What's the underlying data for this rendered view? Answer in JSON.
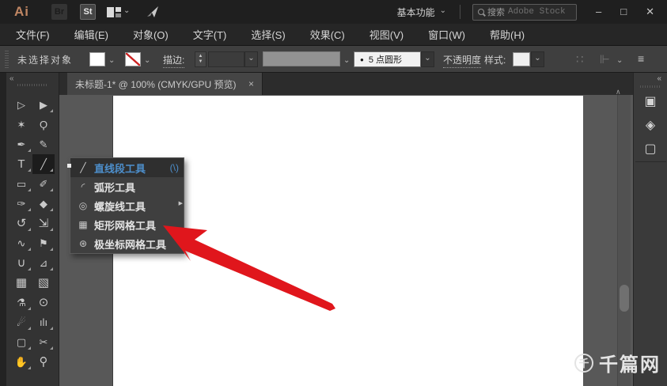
{
  "titlebar": {
    "app_badge": "Ai",
    "bridge_badge": "Br",
    "stock_badge": "St",
    "workspace_label": "基本功能",
    "search_label": "搜索",
    "search_placeholder": "Adobe Stock",
    "minimize": "–",
    "maximize": "□",
    "close": "✕"
  },
  "menubar": {
    "items": [
      {
        "label": "文件(F)"
      },
      {
        "label": "编辑(E)"
      },
      {
        "label": "对象(O)"
      },
      {
        "label": "文字(T)"
      },
      {
        "label": "选择(S)"
      },
      {
        "label": "效果(C)"
      },
      {
        "label": "视图(V)"
      },
      {
        "label": "窗口(W)"
      },
      {
        "label": "帮助(H)"
      }
    ]
  },
  "control_bar": {
    "status": "未选择对象",
    "stroke_label": "描边:",
    "stepper_up": "▲",
    "stepper_down": "▼",
    "brush_bullet": "●",
    "brush_value": "5 点圆形",
    "opacity_label": "不透明度",
    "style_label": "样式:",
    "transform_icon": "∷",
    "align_icon": "⊩",
    "panel_menu_icon": "≡"
  },
  "tabbar": {
    "document_title": "未标题-1* @ 100% (CMYK/GPU 预览)",
    "close": "×"
  },
  "tools_panel": {
    "collapse_chevron": "«",
    "tools": [
      {
        "name": "selection-tool",
        "glyph": "▷"
      },
      {
        "name": "direct-selection-tool",
        "glyph": "▶"
      },
      {
        "name": "magic-wand-tool",
        "glyph": "✶"
      },
      {
        "name": "lasso-tool",
        "glyph": "Ϙ"
      },
      {
        "name": "pen-tool",
        "glyph": "✒"
      },
      {
        "name": "curvature-tool",
        "glyph": "✎"
      },
      {
        "name": "type-tool",
        "glyph": "T"
      },
      {
        "name": "line-segment-tool",
        "glyph": "╱",
        "active": true
      },
      {
        "name": "rectangle-tool",
        "glyph": "▭"
      },
      {
        "name": "paintbrush-tool",
        "glyph": "✐"
      },
      {
        "name": "shaper-tool",
        "glyph": "✑"
      },
      {
        "name": "eraser-tool",
        "glyph": "◆"
      },
      {
        "name": "rotate-tool",
        "glyph": "↺"
      },
      {
        "name": "scale-tool",
        "glyph": "⇲"
      },
      {
        "name": "width-tool",
        "glyph": "∿"
      },
      {
        "name": "puppet-warp-tool",
        "glyph": "⚑"
      },
      {
        "name": "shape-builder-tool",
        "glyph": "∪"
      },
      {
        "name": "perspective-grid-tool",
        "glyph": "⊿"
      },
      {
        "name": "mesh-tool",
        "glyph": "▦"
      },
      {
        "name": "gradient-tool",
        "glyph": "▧"
      },
      {
        "name": "eyedropper-tool",
        "glyph": "⚗"
      },
      {
        "name": "blend-tool",
        "glyph": "⊙"
      },
      {
        "name": "symbol-sprayer-tool",
        "glyph": "☄"
      },
      {
        "name": "column-graph-tool",
        "glyph": "ılı"
      },
      {
        "name": "artboard-tool",
        "glyph": "▢"
      },
      {
        "name": "slice-tool",
        "glyph": "✂"
      },
      {
        "name": "hand-tool",
        "glyph": "✋"
      },
      {
        "name": "zoom-tool",
        "glyph": "⚲"
      }
    ]
  },
  "flyout": {
    "items": [
      {
        "glyph": "╱",
        "label": "直线段工具",
        "shortcut": "(\\)",
        "selected": true
      },
      {
        "glyph": "◜",
        "label": "弧形工具"
      },
      {
        "glyph": "◎",
        "label": "螺旋线工具"
      },
      {
        "glyph": "▦",
        "label": "矩形网格工具"
      },
      {
        "glyph": "⊛",
        "label": "极坐标网格工具"
      }
    ],
    "tearoff_arrow": "▶"
  },
  "canvas": {
    "scroll_up_arrow": "∧"
  },
  "right_dock": {
    "collapse_chevron": "«",
    "icons": [
      {
        "name": "libraries-panel",
        "glyph": "▣"
      },
      {
        "name": "layers-panel",
        "glyph": "◈"
      },
      {
        "name": "artboards-panel",
        "glyph": "▢"
      }
    ]
  },
  "watermark": {
    "badge": "千",
    "text": "千篇网"
  },
  "colors": {
    "accent_blue": "#4d8fcc",
    "arrow_red": "#e0161c",
    "titlebar_bg": "#1f1f1f",
    "panel_bg": "#333333",
    "pasteboard_gray": "#585858"
  }
}
